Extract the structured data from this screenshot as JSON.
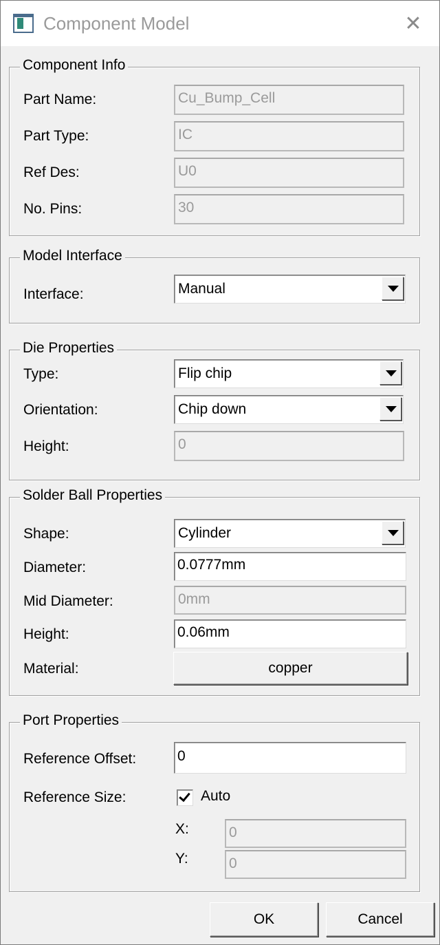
{
  "window": {
    "title": "Component Model",
    "close_glyph": "✕"
  },
  "component_info": {
    "legend": "Component Info",
    "part_name": {
      "label": "Part Name:",
      "value": "Cu_Bump_Cell"
    },
    "part_type": {
      "label": "Part Type:",
      "value": "IC"
    },
    "ref_des": {
      "label": "Ref Des:",
      "value": "U0"
    },
    "no_pins": {
      "label": "No. Pins:",
      "value": "30"
    }
  },
  "model_interface": {
    "legend": "Model Interface",
    "interface": {
      "label": "Interface:",
      "value": "Manual"
    }
  },
  "die_properties": {
    "legend": "Die Properties",
    "type": {
      "label": "Type:",
      "value": "Flip chip"
    },
    "orientation": {
      "label": "Orientation:",
      "value": "Chip down"
    },
    "height": {
      "label": "Height:",
      "value": "0"
    }
  },
  "solder_ball": {
    "legend": "Solder Ball Properties",
    "shape": {
      "label": "Shape:",
      "value": "Cylinder"
    },
    "diameter": {
      "label": "Diameter:",
      "value": "0.0777mm"
    },
    "mid_diameter": {
      "label": "Mid Diameter:",
      "value": "0mm"
    },
    "height": {
      "label": "Height:",
      "value": "0.06mm"
    },
    "material": {
      "label": "Material:",
      "value": "copper"
    }
  },
  "port_properties": {
    "legend": "Port Properties",
    "reference_offset": {
      "label": "Reference Offset:",
      "value": "0"
    },
    "reference_size": {
      "label": "Reference Size:",
      "auto_label": "Auto",
      "auto_checked": true
    },
    "x": {
      "label": "X:",
      "value": "0"
    },
    "y": {
      "label": "Y:",
      "value": "0"
    }
  },
  "buttons": {
    "ok": "OK",
    "cancel": "Cancel"
  }
}
